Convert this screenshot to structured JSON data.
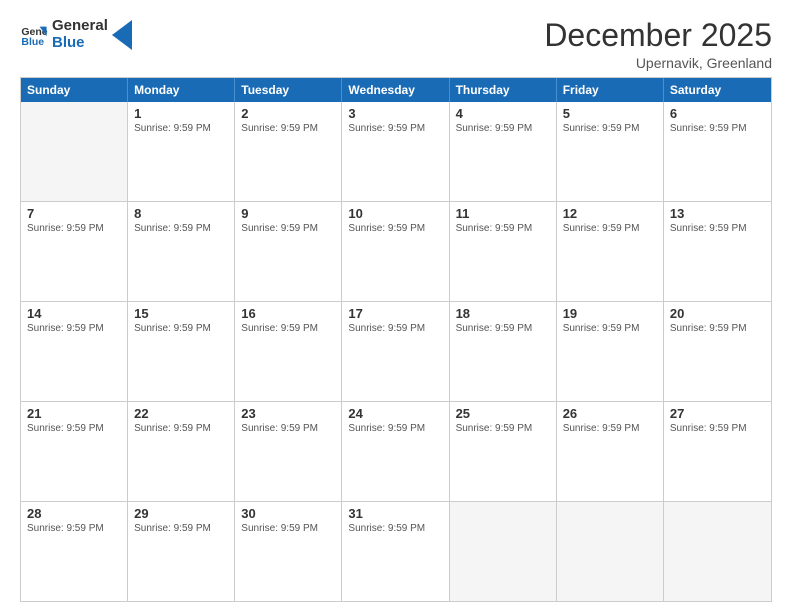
{
  "header": {
    "logo_line1": "General",
    "logo_line2": "Blue",
    "month_year": "December 2025",
    "location": "Upernavik, Greenland"
  },
  "days_of_week": [
    "Sunday",
    "Monday",
    "Tuesday",
    "Wednesday",
    "Thursday",
    "Friday",
    "Saturday"
  ],
  "sunrise_text": "Sunrise: 9:59 PM",
  "weeks": [
    [
      {
        "day": "",
        "empty": true
      },
      {
        "day": "1",
        "sunrise": "Sunrise: 9:59 PM"
      },
      {
        "day": "2",
        "sunrise": "Sunrise: 9:59 PM"
      },
      {
        "day": "3",
        "sunrise": "Sunrise: 9:59 PM"
      },
      {
        "day": "4",
        "sunrise": "Sunrise: 9:59 PM"
      },
      {
        "day": "5",
        "sunrise": "Sunrise: 9:59 PM"
      },
      {
        "day": "6",
        "sunrise": "Sunrise: 9:59 PM"
      }
    ],
    [
      {
        "day": "7",
        "sunrise": "Sunrise: 9:59 PM"
      },
      {
        "day": "8",
        "sunrise": "Sunrise: 9:59 PM"
      },
      {
        "day": "9",
        "sunrise": "Sunrise: 9:59 PM"
      },
      {
        "day": "10",
        "sunrise": "Sunrise: 9:59 PM"
      },
      {
        "day": "11",
        "sunrise": "Sunrise: 9:59 PM"
      },
      {
        "day": "12",
        "sunrise": "Sunrise: 9:59 PM"
      },
      {
        "day": "13",
        "sunrise": "Sunrise: 9:59 PM"
      }
    ],
    [
      {
        "day": "14",
        "sunrise": "Sunrise: 9:59 PM"
      },
      {
        "day": "15",
        "sunrise": "Sunrise: 9:59 PM"
      },
      {
        "day": "16",
        "sunrise": "Sunrise: 9:59 PM"
      },
      {
        "day": "17",
        "sunrise": "Sunrise: 9:59 PM"
      },
      {
        "day": "18",
        "sunrise": "Sunrise: 9:59 PM"
      },
      {
        "day": "19",
        "sunrise": "Sunrise: 9:59 PM"
      },
      {
        "day": "20",
        "sunrise": "Sunrise: 9:59 PM"
      }
    ],
    [
      {
        "day": "21",
        "sunrise": "Sunrise: 9:59 PM"
      },
      {
        "day": "22",
        "sunrise": "Sunrise: 9:59 PM"
      },
      {
        "day": "23",
        "sunrise": "Sunrise: 9:59 PM"
      },
      {
        "day": "24",
        "sunrise": "Sunrise: 9:59 PM"
      },
      {
        "day": "25",
        "sunrise": "Sunrise: 9:59 PM"
      },
      {
        "day": "26",
        "sunrise": "Sunrise: 9:59 PM"
      },
      {
        "day": "27",
        "sunrise": "Sunrise: 9:59 PM"
      }
    ],
    [
      {
        "day": "28",
        "sunrise": "Sunrise: 9:59 PM"
      },
      {
        "day": "29",
        "sunrise": "Sunrise: 9:59 PM"
      },
      {
        "day": "30",
        "sunrise": "Sunrise: 9:59 PM"
      },
      {
        "day": "31",
        "sunrise": "Sunrise: 9:59 PM"
      },
      {
        "day": "",
        "empty": true
      },
      {
        "day": "",
        "empty": true
      },
      {
        "day": "",
        "empty": true
      }
    ]
  ]
}
